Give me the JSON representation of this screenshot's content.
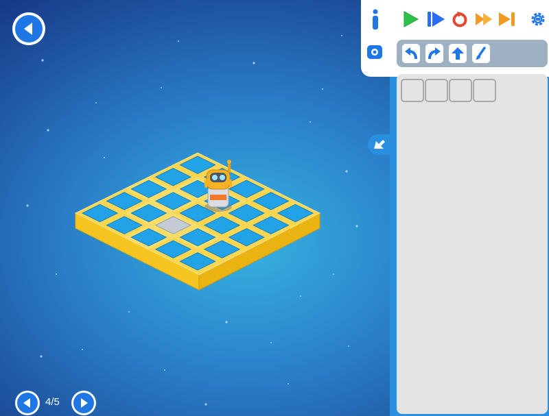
{
  "level": {
    "current": 4,
    "total": 5,
    "indicator": "4/5"
  },
  "icons": {
    "back": "back-arrow-icon",
    "prev": "previous-level-icon",
    "next": "next-level-icon",
    "info": "info-icon",
    "camera": "camera-icon",
    "play": "play-icon",
    "step": "step-icon",
    "reset": "reset-icon",
    "fast": "fast-forward-icon",
    "skip": "skip-to-end-icon",
    "settings": "gear-icon",
    "collapse": "collapse-arrow-icon"
  },
  "commands": [
    "turn-left",
    "turn-right",
    "move-forward",
    "paint"
  ],
  "program_slots": 4,
  "colors": {
    "space_center": "#33a9dc",
    "space_edge": "#163a86",
    "tile": "#23a3e7",
    "board_side": "#f2c31c",
    "accent_blue": "#1f77e6",
    "play_green": "#2fc14a",
    "reset_red": "#e8472f",
    "fast_orange": "#f39a23"
  }
}
